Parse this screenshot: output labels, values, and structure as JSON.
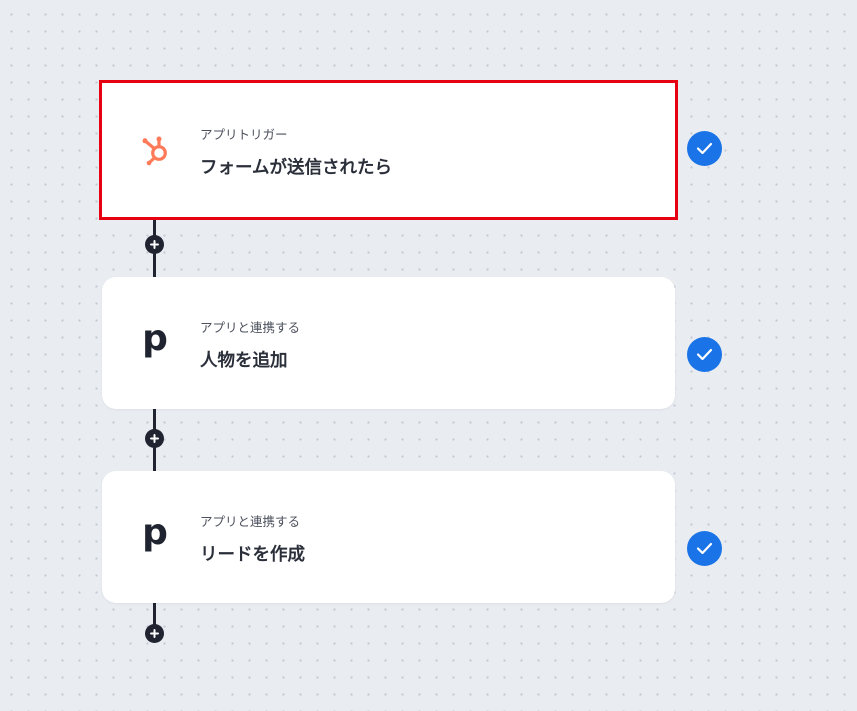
{
  "flow": {
    "steps": [
      {
        "app_icon": "hubspot-icon",
        "subtitle": "アプリトリガー",
        "title": "フォームが送信されたら",
        "status_icon": "check-icon",
        "selected": true
      },
      {
        "app_icon": "pipedrive-icon",
        "app_letter": "p",
        "subtitle": "アプリと連携する",
        "title": "人物を追加",
        "status_icon": "check-icon",
        "selected": false
      },
      {
        "app_icon": "pipedrive-icon",
        "app_letter": "p",
        "subtitle": "アプリと連携する",
        "title": "リードを作成",
        "status_icon": "check-icon",
        "selected": false
      }
    ],
    "add_step_icon": "plus-icon"
  },
  "colors": {
    "selection_border": "#e60012",
    "check_badge": "#1a74e8",
    "hubspot_orange": "#ff7a59",
    "connector": "#1f2430",
    "background": "#e9ecf1"
  }
}
